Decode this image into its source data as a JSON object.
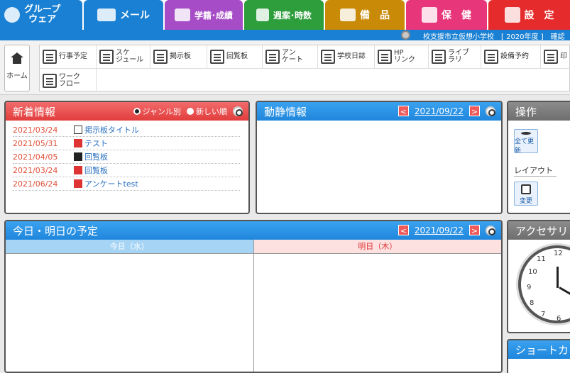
{
  "nav": {
    "groupware": "グループ\nウェア",
    "groupware_line1": "グループ",
    "groupware_line2": "ウェア",
    "mail": "メール",
    "gakuseki": "学籍･成績",
    "shuan": "週案･時数",
    "bihin": "備　品",
    "hoken": "保　健",
    "settei": "設　定"
  },
  "infobar": {
    "school": "校支援市立仮想小学校　[ 2020年度 ]　確認"
  },
  "toolbar": {
    "home": "ホーム",
    "row1": [
      {
        "label": "行事予定"
      },
      {
        "label": "スケ\nジュール"
      },
      {
        "label": "掲示板"
      },
      {
        "label": "回覧板"
      },
      {
        "label": "アン\nケート"
      },
      {
        "label": "学校日誌"
      },
      {
        "label": "HP\nリンク"
      },
      {
        "label": "ライブ\nラリ"
      },
      {
        "label": "設備予約"
      },
      {
        "label": "印"
      }
    ],
    "row2": [
      {
        "label": "ワーク\nフロー"
      }
    ]
  },
  "news": {
    "title": "新着情報",
    "radio_genre": "ジャンル別",
    "radio_new": "新しい順",
    "items": [
      {
        "date": "2021/03/24",
        "title": "掲示板タイトル"
      },
      {
        "date": "2021/05/31",
        "title": "テスト"
      },
      {
        "date": "2021/04/05",
        "title": "回覧板"
      },
      {
        "date": "2021/03/24",
        "title": "回覧板"
      },
      {
        "date": "2021/06/24",
        "title": "アンケートtest"
      }
    ]
  },
  "doseki": {
    "title": "動静情報",
    "date": "2021/09/22"
  },
  "sousa": {
    "title": "操作",
    "refresh_all": "全て更新",
    "layout": "レイアウト",
    "change": "変更"
  },
  "schedule": {
    "title": "今日・明日の予定",
    "date": "2021/09/22",
    "today": "今日（水）",
    "tomorrow": "明日（木）"
  },
  "accessory": {
    "title": "アクセサリ"
  },
  "shortcut": {
    "title": "ショートカ"
  }
}
